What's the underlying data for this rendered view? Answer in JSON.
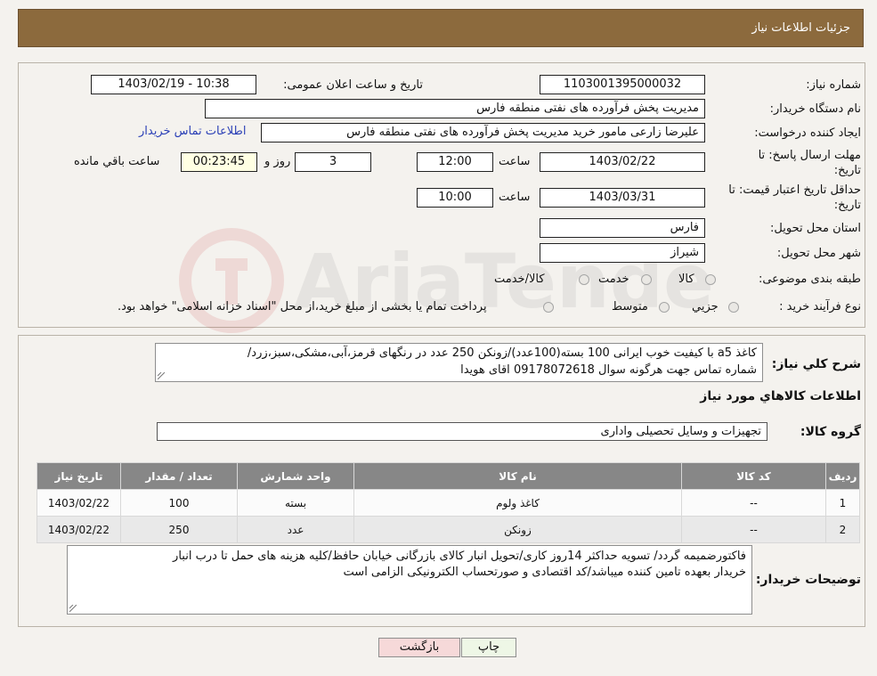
{
  "header": {
    "title": "جزئیات اطلاعات نیاز"
  },
  "fields": {
    "need_number_label": "شماره نیاز:",
    "need_number": "1103001395000032",
    "announce_label": "تاریخ و ساعت اعلان عمومی:",
    "announce_value": "1403/02/19 - 10:38",
    "buyer_org_label": "نام دستگاه خریدار:",
    "buyer_org": "مدیریت پخش فرآورده های نفتی منطقه فارس",
    "creator_label": "ایجاد کننده درخواست:",
    "creator": "علیرضا زارعی مامور خرید مدیریت پخش فرآورده های نفتی منطقه فارس",
    "contact_link": "اطلاعات تماس خریدار",
    "reply_deadline_label_1": "مهلت ارسال پاسخ: تا",
    "reply_deadline_label_2": "تاریخ:",
    "reply_date": "1403/02/22",
    "time_label": "ساعت",
    "reply_time": "12:00",
    "days_value": "3",
    "days_label": "روز و",
    "remaining_time": "00:23:45",
    "remaining_label": "ساعت باقي مانده",
    "price_validity_label_1": "حداقل تاریخ اعتبار قیمت: تا",
    "price_validity_label_2": "تاریخ:",
    "price_date": "1403/03/31",
    "price_time_label": "ساعت",
    "price_time": "10:00",
    "province_label": "استان محل تحویل:",
    "province": "فارس",
    "city_label": "شهر محل تحویل:",
    "city": "شیراز",
    "category_label": "طبقه بندی موضوعی:",
    "category_options": [
      "کالا",
      "خدمت",
      "کالا/خدمت"
    ],
    "category_selected": "کالا",
    "process_label": "نوع فرآیند خرید :",
    "process_options": [
      "جزيي",
      "متوسط"
    ],
    "process_note": "پرداخت تمام یا بخشی از مبلغ خرید،از محل \"اسناد خزانه اسلامی\" خواهد بود."
  },
  "description": {
    "label": "شرح کلي نياز:",
    "line1": "کاغذ a5 با کیفیت خوب ایرانی 100 بسته(100عدد)/زونکن 250 عدد در رنگهای قرمز،آبی،مشکی،سبز،زرد/",
    "line2": "شماره تماس جهت هرگونه سوال 09178072618 اقای هویدا"
  },
  "goods_section_title": "اطلاعات کالاهاي مورد نياز",
  "goods_group_label": "گروه کالا:",
  "goods_group": "تجهیزات و وسایل تحصیلی واداری",
  "table": {
    "headers": [
      "رديف",
      "کد کالا",
      "نام کالا",
      "واحد شمارش",
      "تعداد / مقدار",
      "تاریخ نیاز"
    ],
    "rows": [
      [
        "1",
        "--",
        "کاغذ ولوم",
        "بسته",
        "100",
        "1403/02/22"
      ],
      [
        "2",
        "--",
        "زونکن",
        "عدد",
        "250",
        "1403/02/22"
      ]
    ]
  },
  "buyer_notes": {
    "label": "توضیحات خریدار:",
    "line1": "فاکتورضمیمه گردد/ تسویه حداکثر 14روز کاری/تحویل انبار کالای بازرگانی خیابان حافظ/کلیه هزینه های حمل تا درب انبار",
    "line2": "خریدار بعهده تامین کننده میباشد/کد اقتصادی و صورتحساب الکترونیکی الزامی است"
  },
  "buttons": {
    "print": "چاپ",
    "back": "بازگشت"
  },
  "watermark": "AriaTender.neT",
  "colors": {
    "header": "#8c6a3d",
    "link": "#2a3fb6",
    "back_button": "#f6d9d9",
    "print_button": "#eef7e6"
  }
}
